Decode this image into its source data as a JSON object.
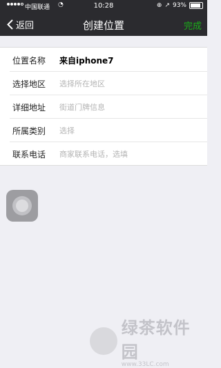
{
  "status_bar": {
    "carrier": "中国联通",
    "time": "10:28",
    "battery": "93%",
    "battery_level": 0.93
  },
  "nav": {
    "back_label": "返回",
    "title": "创建位置",
    "done_label": "完成"
  },
  "form": {
    "rows": [
      {
        "label": "位置名称",
        "value": "来自iphone7",
        "placeholder": ""
      },
      {
        "label": "选择地区",
        "value": "",
        "placeholder": "选择所在地区"
      },
      {
        "label": "详细地址",
        "value": "",
        "placeholder": "街道门牌信息"
      },
      {
        "label": "所属类别",
        "value": "",
        "placeholder": "选择"
      },
      {
        "label": "联系电话",
        "value": "",
        "placeholder": "商家联系电话，选填"
      }
    ]
  },
  "watermark": {
    "text": "绿茶软件园",
    "url": "www.33LC.com"
  },
  "colors": {
    "header_bg": "#2b2b2f",
    "accent": "#1aad19",
    "page_bg": "#efeff4"
  }
}
